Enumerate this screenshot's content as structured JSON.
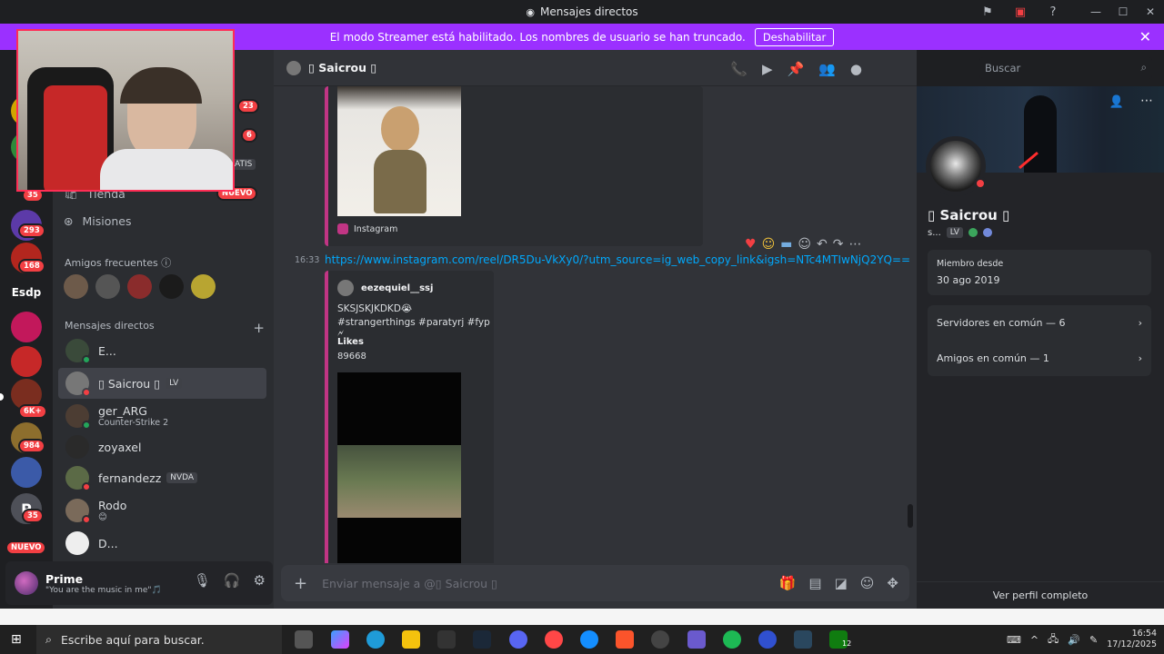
{
  "window": {
    "title": "Mensajes directos"
  },
  "streamer_bar": {
    "message": "El modo Streamer está habilitado. Los nombres de usuario se han truncado.",
    "button": "Deshabilitar"
  },
  "rail": {
    "badges": [
      "23",
      "6",
      "ATIS",
      "NUEVO",
      "35",
      "293",
      "168",
      "6K+",
      "984",
      "35",
      "NUEVO"
    ],
    "esdp_label": "Esdp"
  },
  "sidebar": {
    "nav": [
      {
        "label": "Tienda"
      },
      {
        "label": "Misiones"
      }
    ],
    "friends_label": "Amigos frecuentes",
    "dm_label": "Mensajes directos",
    "dms": [
      {
        "name": "E...",
        "sub": "",
        "tag": ""
      },
      {
        "name": "▯ Saicrou ▯",
        "sub": "",
        "tag": "LV"
      },
      {
        "name": "ger_ARG",
        "sub": "Counter-Strike 2",
        "tag": ""
      },
      {
        "name": "zoyaxel",
        "sub": "",
        "tag": ""
      },
      {
        "name": "fernandezz",
        "sub": "",
        "tag": "NVDA"
      },
      {
        "name": "Rodo",
        "sub": "😊",
        "tag": ""
      },
      {
        "name": "D...",
        "sub": "",
        "tag": ""
      }
    ]
  },
  "user_panel": {
    "name": "Prime",
    "status": "\"You are the music in me\"🎵"
  },
  "chat": {
    "header_name": "▯ Saicrou ▯",
    "search_placeholder": "Buscar",
    "embed1_source": "Instagram",
    "timestamp": "16:33",
    "link": "https://www.instagram.com/reel/DR5Du-VkXy0/?utm_source=ig_web_copy_link&igsh=NTc4MTIwNjQ2YQ==",
    "embed2": {
      "author": "eezequiel__ssj",
      "text1": "SKSJSKJKDKD😭",
      "text2": "#strangerthings #paratyrj #fyp🗲",
      "likes_label": "Likes",
      "likes_value": "89668"
    },
    "composer_placeholder": "Enviar mensaje a @▯ Saicrou ▯"
  },
  "profile": {
    "name": "▯ Saicrou ▯",
    "sub": "s...",
    "sub_tag": "LV",
    "member_since_label": "Miembro desde",
    "member_since_value": "30 ago 2019",
    "servers": "Servidores en común — 6",
    "friends": "Amigos en común — 1",
    "footer": "Ver perfil completo"
  },
  "taskbar": {
    "search": "Escribe aquí para buscar.",
    "time": "16:54",
    "date": "17/12/2025",
    "xbox_badge": "12"
  },
  "colors": {
    "streamer": "#9b30ff",
    "accent_link": "#00a8fc",
    "embed_border": "#c13584",
    "badge_red": "#f23f43"
  }
}
